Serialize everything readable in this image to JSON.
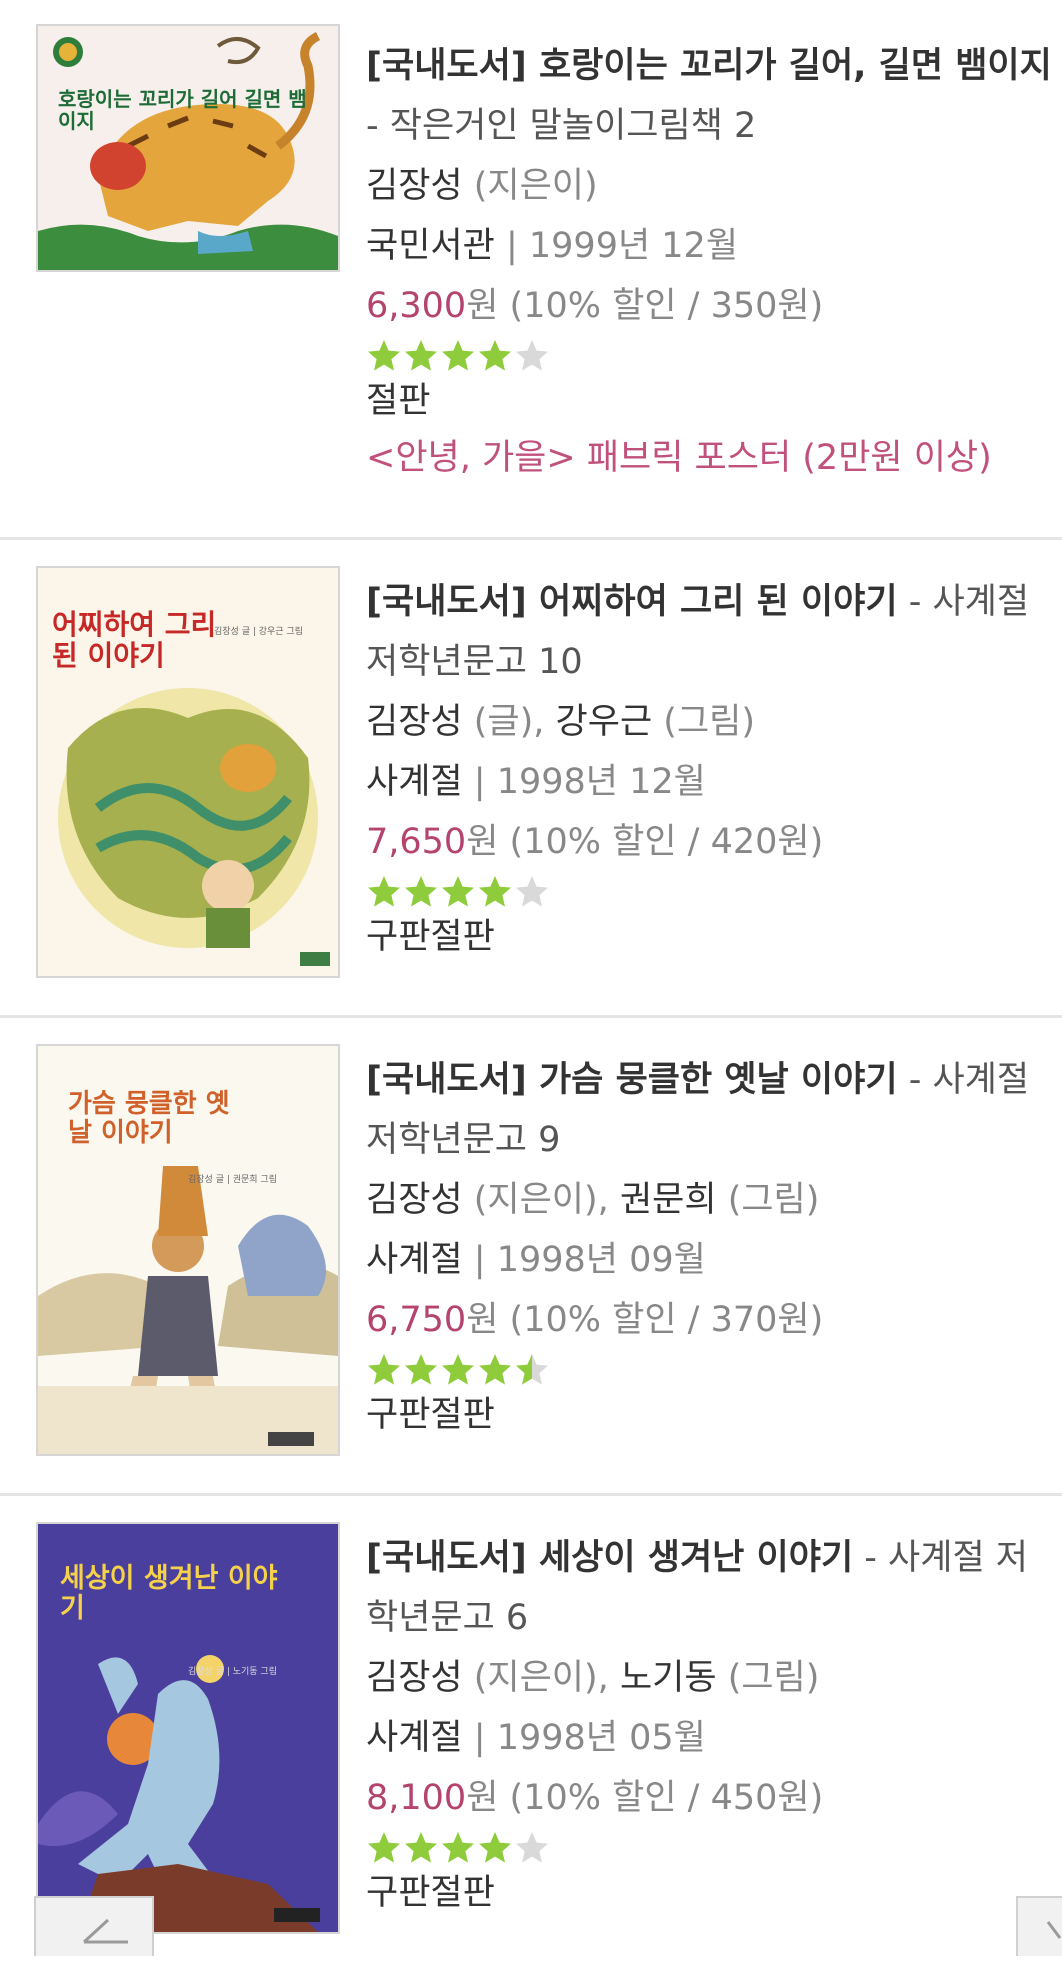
{
  "books": [
    {
      "title": "[국내도서] 호랑이는 꼬리가 길어, 길면 뱀이지",
      "subtitle": "- 작은거인 말놀이그림책 2",
      "authors": [
        {
          "name": "김장성",
          "role": "(지은이)"
        }
      ],
      "publisher": "국민서관",
      "date": "1999년 12월",
      "price": "6,300",
      "currency": "원",
      "discount": "(10% 할인 / 350원)",
      "rating": 4,
      "status": "절판",
      "promo": "<안녕, 가을> 패브릭 포스터 (2만원 이상)",
      "cover": {
        "title": "호랑이는 꼬리가 길어 길면 뱀이지",
        "bg": "#f7f2ef"
      }
    },
    {
      "title": "[국내도서] 어찌하여 그리 된 이야기",
      "subtitle": "- 사계절 저학년문고 10",
      "authors": [
        {
          "name": "김장성",
          "role": "(글)"
        },
        {
          "name": "강우근",
          "role": "(그림)"
        }
      ],
      "publisher": "사계절",
      "date": "1998년 12월",
      "price": "7,650",
      "currency": "원",
      "discount": "(10% 할인 / 420원)",
      "rating": 4,
      "status": "구판절판",
      "cover": {
        "title": "어찌하여 그리 된 이야기",
        "credit": "김장성 글 | 강우근 그림"
      }
    },
    {
      "title": "[국내도서] 가슴 뭉클한 옛날 이야기",
      "subtitle": "- 사계절 저학년문고 9",
      "authors": [
        {
          "name": "김장성",
          "role": "(지은이)"
        },
        {
          "name": "권문희",
          "role": "(그림)"
        }
      ],
      "publisher": "사계절",
      "date": "1998년 09월",
      "price": "6,750",
      "currency": "원",
      "discount": "(10% 할인 / 370원)",
      "rating": 4.5,
      "status": "구판절판",
      "cover": {
        "title": "가슴 뭉클한 옛날 이야기",
        "credit": "김장성 글 | 권문희 그림"
      }
    },
    {
      "title": "[국내도서] 세상이 생겨난 이야기",
      "subtitle": "- 사계절 저학년문고 6",
      "authors": [
        {
          "name": "김장성",
          "role": "(지은이)"
        },
        {
          "name": "노기동",
          "role": "(그림)"
        }
      ],
      "publisher": "사계절",
      "date": "1998년 05월",
      "price": "8,100",
      "currency": "원",
      "discount": "(10% 할인 / 450원)",
      "rating": 4,
      "status": "구판절판",
      "cover": {
        "title": "세상이 생겨난 이야기",
        "credit": "김장성 글 | 노기동 그림"
      }
    }
  ],
  "colors": {
    "price": "#b4436e",
    "promo": "#c0507c",
    "star_on": "#8fcc3b",
    "star_off": "#d9d9d9"
  },
  "nav": {
    "prev_icon": "chevron-left-icon",
    "next_icon": "chevron-right-icon"
  }
}
